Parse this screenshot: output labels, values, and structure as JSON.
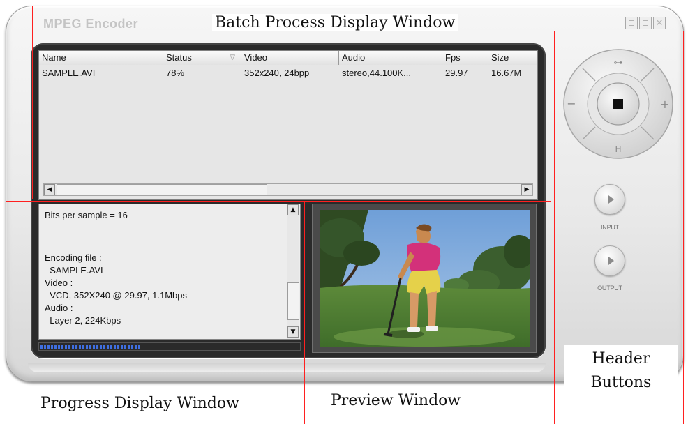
{
  "app": {
    "title": "MPEG Encoder"
  },
  "batch_list": {
    "columns": [
      "Name",
      "Status",
      "Video",
      "Audio",
      "Fps",
      "Size"
    ],
    "rows": [
      [
        "SAMPLE.AVI",
        "78%",
        "352x240, 24bpp",
        "stereo,44.100K...",
        "29.97",
        "16.67M"
      ]
    ]
  },
  "log": {
    "lines": [
      "Bits per sample = 16",
      "",
      "",
      "Encoding file :",
      "  SAMPLE.AVI",
      "Video :",
      "  VCD, 352X240 @ 29.97, 1.1Mbps",
      "Audio :",
      "  Layer 2, 224Kbps"
    ],
    "progress_fraction": 0.78
  },
  "controls": {
    "dial_top": "⊶",
    "dial_left": "−",
    "dial_right": "+",
    "dial_bottom": "H",
    "input_label": "INPUT",
    "output_label": "OUTPUT"
  },
  "annotations": {
    "batch": "Batch Process Display Window",
    "progress": "Progress Display Window",
    "preview": "Preview Window",
    "header_line1": "Header",
    "header_line2": "Buttons"
  },
  "colors": {
    "annotation_border": "#ff2020",
    "progress_fill": "#3f6fe0"
  },
  "icons": [
    "minimize-icon",
    "maximize-icon",
    "close-icon",
    "stop-icon",
    "link-icon",
    "play-icon",
    "arrow-left-icon",
    "arrow-right-icon",
    "arrow-up-icon",
    "arrow-down-icon"
  ]
}
